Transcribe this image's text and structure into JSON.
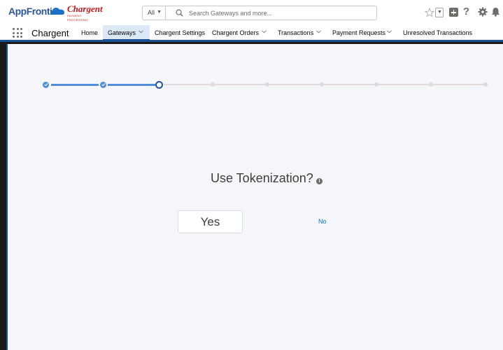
{
  "brand": {
    "appfrontier_logo": "AppFrontier",
    "chargent_logo": "Chargent",
    "chargent_tagline": "PAYMENT PROCESSING"
  },
  "header": {
    "search_scope": "All",
    "search_placeholder": "Search Gateways and more...",
    "help_glyph": "?"
  },
  "nav": {
    "app_name": "Chargent",
    "items": [
      {
        "label": "Home",
        "has_dropdown": false,
        "active": false
      },
      {
        "label": "Gateways",
        "has_dropdown": true,
        "active": true
      },
      {
        "label": "Chargent Settings",
        "has_dropdown": false,
        "active": false
      },
      {
        "label": "Chargent Orders",
        "has_dropdown": true,
        "active": false
      },
      {
        "label": "Transactions",
        "has_dropdown": true,
        "active": false
      },
      {
        "label": "Payment Requests",
        "has_dropdown": true,
        "active": false
      },
      {
        "label": "Unresolved Transactions",
        "has_dropdown": false,
        "active": false
      }
    ]
  },
  "wizard": {
    "steps_total": 9,
    "steps_completed": 2,
    "current_step": 3,
    "question": "Use Tokenization?",
    "info_glyph": "i",
    "yes_label": "Yes",
    "no_label": "No"
  },
  "colors": {
    "brand_blue": "#1b5297",
    "progress_done": "#4f8ed8",
    "link_blue": "#0070d2",
    "chargent_red": "#c4161c"
  }
}
